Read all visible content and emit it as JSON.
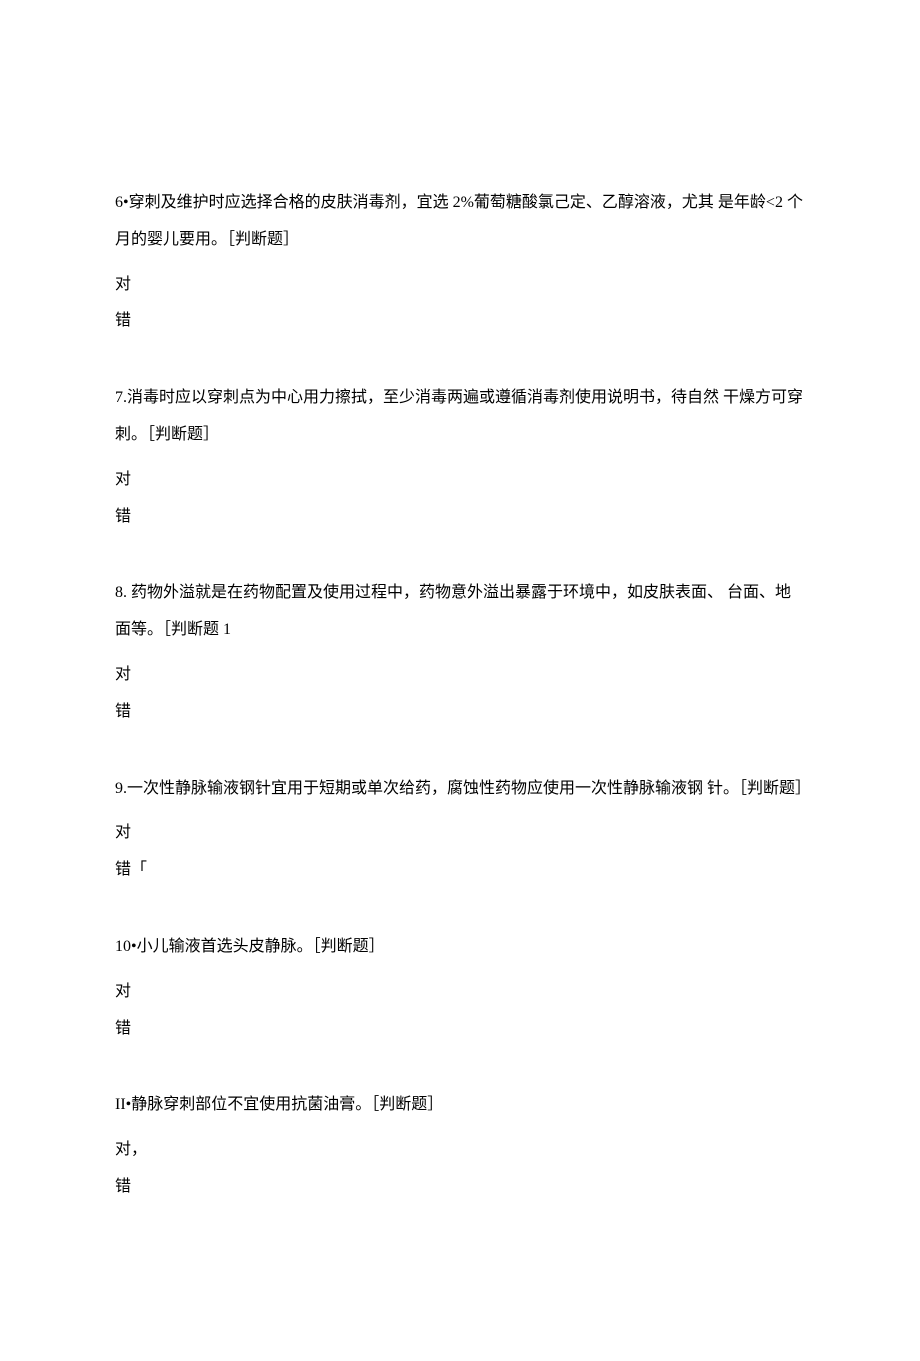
{
  "questions": [
    {
      "text": "6•穿刺及维护时应选择合格的皮肤消毒剂，宜选 2%葡萄糖酸氯己定、乙醇溶液，尤其 是年龄<2 个月的婴儿要用。［判断题］",
      "option1": "对",
      "option2": "错"
    },
    {
      "text": "7.消毒时应以穿刺点为中心用力擦拭，至少消毒两遍或遵循消毒剂使用说明书，待自然 干燥方可穿刺。［判断题］",
      "option1": "对",
      "option2": "错"
    },
    {
      "text": "8. 药物外溢就是在药物配置及使用过程中，药物意外溢出暴露于环境中，如皮肤表面、 台面、地面等。［判断题 1",
      "option1": "对",
      "option2": "错"
    },
    {
      "text": "9.一次性静脉输液钢针宜用于短期或单次给药，腐蚀性药物应使用一次性静脉输液钢 针。［判断题］",
      "option1": "对",
      "option2": "错「"
    },
    {
      "text": "10•小儿输液首选头皮静脉。［判断题］",
      "option1": "对",
      "option2": "错"
    },
    {
      "text": "II•静脉穿刺部位不宜使用抗菌油膏。［判断题］",
      "option1": "对，",
      "option2": "错"
    }
  ]
}
